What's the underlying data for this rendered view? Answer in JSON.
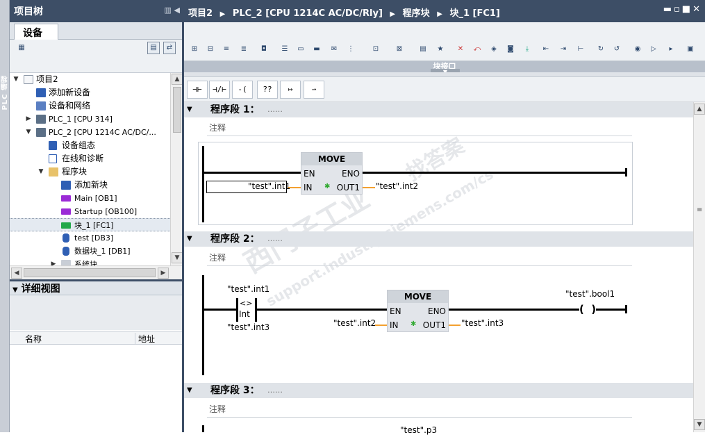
{
  "sidebar": {
    "vertical_label": "PLC 编程"
  },
  "project_tree": {
    "title": "项目树",
    "tab": "设备",
    "items": [
      {
        "label": "项目2",
        "level": 0,
        "expanded": true,
        "icon": "project-icon"
      },
      {
        "label": "添加新设备",
        "level": 1,
        "icon": "add-device-icon"
      },
      {
        "label": "设备和网络",
        "level": 1,
        "icon": "network-icon"
      },
      {
        "label": "PLC_1 [CPU 314]",
        "level": 1,
        "expanded": false,
        "icon": "plc-icon"
      },
      {
        "label": "PLC_2 [CPU 1214C AC/DC/...",
        "level": 1,
        "expanded": true,
        "icon": "plc-icon"
      },
      {
        "label": "设备组态",
        "level": 2,
        "icon": "device-config-icon"
      },
      {
        "label": "在线和诊断",
        "level": 2,
        "icon": "online-diag-icon"
      },
      {
        "label": "程序块",
        "level": 2,
        "expanded": true,
        "icon": "folder-icon"
      },
      {
        "label": "添加新块",
        "level": 3,
        "icon": "add-block-icon"
      },
      {
        "label": "Main [OB1]",
        "level": 3,
        "icon": "ob-icon"
      },
      {
        "label": "Startup [OB100]",
        "level": 3,
        "icon": "ob-icon"
      },
      {
        "label": "块_1 [FC1]",
        "level": 3,
        "icon": "fc-icon",
        "selected": true
      },
      {
        "label": "test [DB3]",
        "level": 3,
        "icon": "db-icon"
      },
      {
        "label": "数据块_1 [DB1]",
        "level": 3,
        "icon": "db-icon"
      },
      {
        "label": "系统块",
        "level": 3,
        "expanded": false,
        "icon": "folder-icon"
      }
    ]
  },
  "detail_view": {
    "title": "详细视图",
    "columns": [
      "名称",
      "地址"
    ]
  },
  "editor": {
    "breadcrumb": [
      "项目2",
      "PLC_2 [CPU 1214C AC/DC/Rly]",
      "程序块",
      "块_1 [FC1]"
    ],
    "interface_label": "块接口",
    "ladder_buttons": [
      "⊣⊢",
      "⊣/⊢",
      "-( )-",
      "??",
      "↦",
      "⇀"
    ],
    "networks": [
      {
        "title": "程序段 1：",
        "dots": "……",
        "comment": "注释",
        "box": {
          "name": "MOVE",
          "en": "EN",
          "eno": "ENO",
          "in": "IN",
          "out": "OUT1"
        },
        "in_var": "\"test\".int1",
        "out_var": "\"test\".int2"
      },
      {
        "title": "程序段 2：",
        "dots": "……",
        "comment": "注释",
        "compare": {
          "top_var": "\"test\".int1",
          "op": "<>",
          "type": "Int",
          "bottom_var": "\"test\".int3"
        },
        "box": {
          "name": "MOVE",
          "en": "EN",
          "eno": "ENO",
          "in": "IN",
          "out": "OUT1"
        },
        "in_var": "\"test\".int2",
        "out_var": "\"test\".int3",
        "coil_var": "\"test\".bool1"
      },
      {
        "title": "程序段 3：",
        "dots": "……",
        "comment": "注释",
        "partial_var": "\"test\".p3"
      }
    ]
  },
  "watermark": {
    "line1": "西门子工业",
    "line2": "support.industry.siemens.com/cs",
    "line3": "找答案"
  },
  "colors": {
    "title_bar": "#3d4e66",
    "wire_orange": "#f3a030",
    "box_fill": "#e2e5ea"
  }
}
